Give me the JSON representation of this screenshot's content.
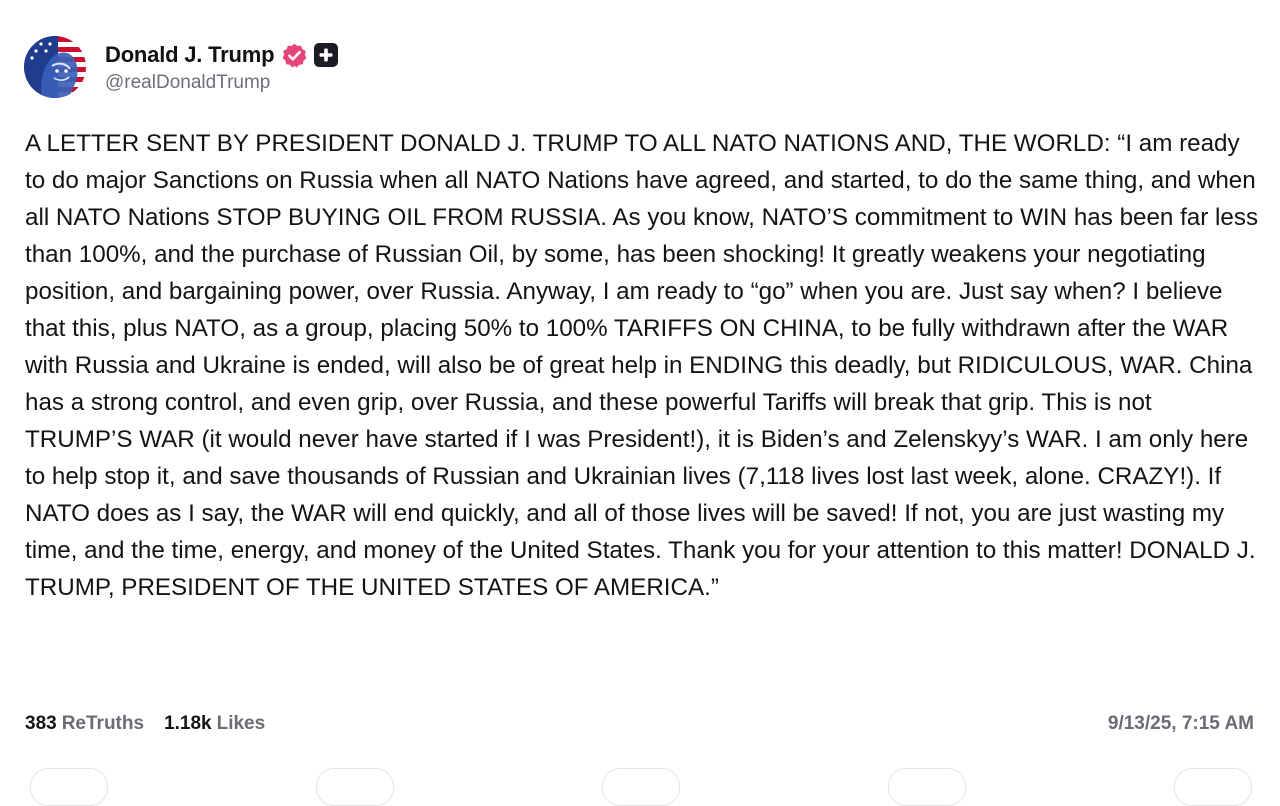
{
  "author": {
    "display_name": "Donald J. Trump",
    "handle": "@realDonaldTrump",
    "verified_icon": "verified-badge-icon",
    "verified_color": "#e5457a",
    "plus_icon": "plus-square-icon"
  },
  "post": {
    "text": "A LETTER SENT BY PRESIDENT DONALD J. TRUMP TO ALL NATO NATIONS AND, THE WORLD: “I am ready to do major Sanctions on Russia when all NATO Nations have agreed, and started, to do the same thing, and when all NATO Nations STOP BUYING OIL FROM RUSSIA. As you know, NATO’S commitment to WIN has been far less than 100%, and the purchase of Russian Oil, by some, has been shocking! It greatly weakens your negotiating position, and bargaining power, over Russia. Anyway, I am ready to “go” when you are. Just say when? I believe that this, plus NATO, as a group, placing 50% to 100% TARIFFS ON CHINA, to be fully withdrawn after the WAR with Russia and Ukraine is ended, will also be of great help in ENDING this deadly, but RIDICULOUS, WAR. China has a strong control, and even grip, over Russia, and these powerful Tariffs will break that grip. This is not TRUMP’S WAR (it would never have started if I was President!), it is Biden’s and Zelenskyy’s WAR. I am only here to help stop it, and save thousands of Russian and Ukrainian lives (7,118 lives lost last week, alone. CRAZY!). If NATO does as I say, the WAR will end quickly, and all of those lives will be saved! If not, you are just wasting my time, and the time, energy, and money of the United States. Thank you for your attention to this matter! DONALD J. TRUMP, PRESIDENT OF THE UNITED STATES OF AMERICA.”",
    "retruths_count": "383",
    "retruths_label": "ReTruths",
    "likes_count": "1.18k",
    "likes_label": "Likes",
    "timestamp": "9/13/25, 7:15 AM"
  },
  "actions": [
    "reply-icon",
    "retruth-icon",
    "like-icon",
    "share-icon",
    "more-icon"
  ]
}
